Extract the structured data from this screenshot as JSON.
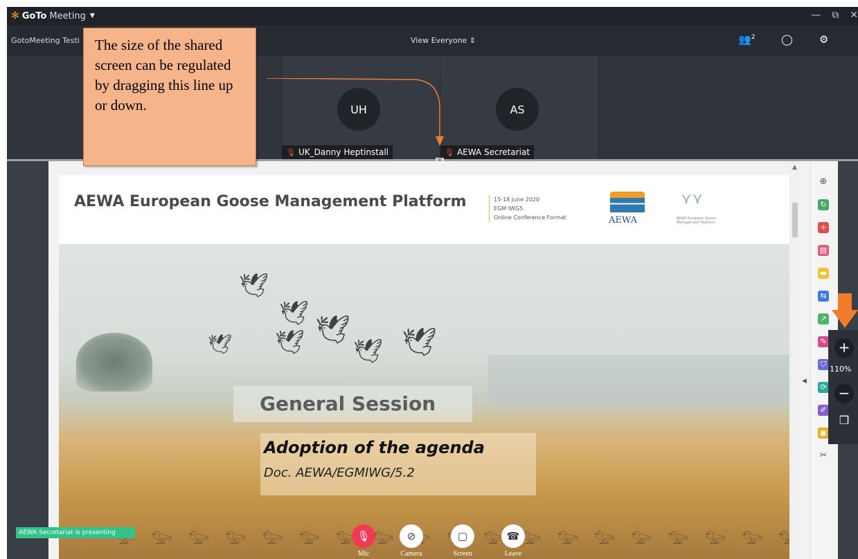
{
  "app": {
    "logo_bold": "GoTo",
    "logo_rest": "Meeting",
    "meeting_name": "GotoMeeting Testi",
    "view_mode": "View Everyone",
    "attendee_count": "2"
  },
  "attendees": [
    {
      "initials": "UH",
      "name": "UK_Danny Heptinstall",
      "muted": true
    },
    {
      "initials": "AS",
      "name": "AEWA Secretariat",
      "muted": true
    }
  ],
  "callout": {
    "text": "The size of the shared screen can be regulated by dragging this line up or down."
  },
  "slide": {
    "title": "AEWA European Goose Management Platform",
    "meta_line1": "15-18 June 2020",
    "meta_line2": "EGM IWG5",
    "meta_line3": "Online Conference Format",
    "aewa_logo_text": "AEWA",
    "egmp_logo_text": "AEWA European Goose Management Platform",
    "session": "General Session",
    "agenda_title": "Adoption of the agenda",
    "agenda_doc": "Doc. AEWA/EGMIWG/5.2"
  },
  "zoom": {
    "level": "110%"
  },
  "status": {
    "presenting": "AEWA Secretariat is presenting"
  },
  "controls": {
    "mic": "Mic",
    "camera": "Camera",
    "screen": "Screen",
    "leave": "Leave"
  },
  "colors": {
    "accent_orange": "#f07d2c",
    "callout_fill": "#f5b48a",
    "mic_red": "#ef3b53",
    "presenting_green": "#33c28a"
  }
}
